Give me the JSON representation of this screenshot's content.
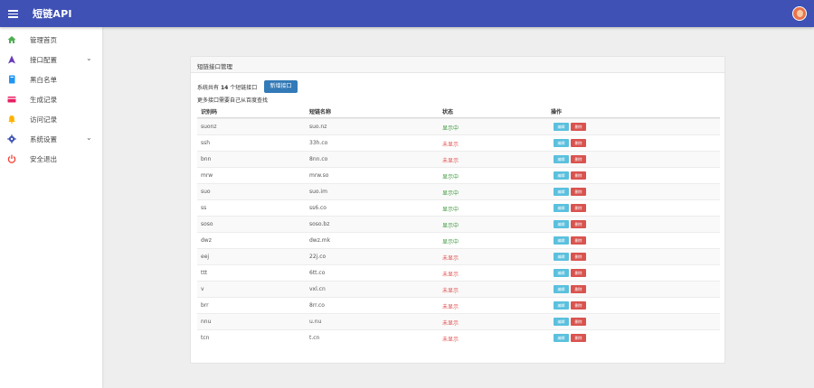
{
  "app": {
    "title": "短链API"
  },
  "sidebar": {
    "items": [
      {
        "label": "管理首页",
        "icon": "home-icon",
        "color": "#4caf50"
      },
      {
        "label": "接口配置",
        "icon": "navigation-icon",
        "color": "#673ab7",
        "expandable": true
      },
      {
        "label": "黑白名单",
        "icon": "book-icon",
        "color": "#2196f3"
      },
      {
        "label": "生成记录",
        "icon": "card-icon",
        "color": "#e91e63"
      },
      {
        "label": "访问记录",
        "icon": "bell-icon",
        "color": "#ffb300"
      },
      {
        "label": "系统设置",
        "icon": "gear-icon",
        "color": "#3f51b5",
        "expandable": true
      },
      {
        "label": "安全退出",
        "icon": "power-icon",
        "color": "#f44336"
      }
    ]
  },
  "card": {
    "title": "短链接口管理",
    "summary_prefix": "系统共有",
    "count": "14",
    "summary_suffix": "个短链接口",
    "add_button": "新增接口",
    "hint": "更多接口需要自己从百度查找",
    "headers": {
      "id": "识别码",
      "name": "短链名称",
      "status": "状态",
      "actions": "操作"
    },
    "edit_label": "编辑",
    "delete_label": "删除",
    "rows": [
      {
        "id": "suonz",
        "name": "suo.nz",
        "status": "显示中",
        "on": true
      },
      {
        "id": "ssh",
        "name": "33h.co",
        "status": "未显示",
        "on": false
      },
      {
        "id": "bnn",
        "name": "8nn.co",
        "status": "未显示",
        "on": false
      },
      {
        "id": "mrw",
        "name": "mrw.so",
        "status": "显示中",
        "on": true
      },
      {
        "id": "suo",
        "name": "suo.im",
        "status": "显示中",
        "on": true
      },
      {
        "id": "ss",
        "name": "ss6.co",
        "status": "显示中",
        "on": true
      },
      {
        "id": "soso",
        "name": "soso.bz",
        "status": "显示中",
        "on": true
      },
      {
        "id": "dwz",
        "name": "dwz.mk",
        "status": "显示中",
        "on": true
      },
      {
        "id": "eej",
        "name": "22j.co",
        "status": "未显示",
        "on": false
      },
      {
        "id": "ttt",
        "name": "6tt.co",
        "status": "未显示",
        "on": false
      },
      {
        "id": "v",
        "name": "vxl.cn",
        "status": "未显示",
        "on": false
      },
      {
        "id": "brr",
        "name": "8rr.co",
        "status": "未显示",
        "on": false
      },
      {
        "id": "nnu",
        "name": "u.nu",
        "status": "未显示",
        "on": false
      },
      {
        "id": "tcn",
        "name": "t.cn",
        "status": "未显示",
        "on": false
      }
    ]
  }
}
